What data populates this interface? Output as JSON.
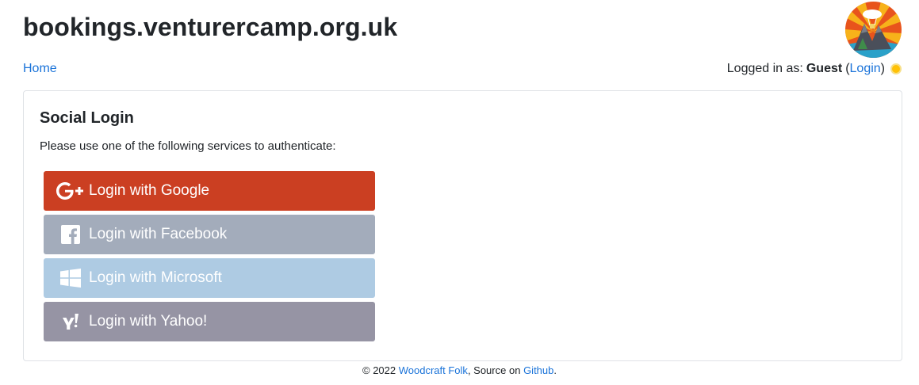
{
  "header": {
    "site_title": "bookings.venturercamp.org.uk",
    "logo_icon": "venturer-camp-logo-icon"
  },
  "nav": {
    "home_label": "Home",
    "logged_in_prefix": "Logged in as:",
    "user_name": "Guest",
    "login_open": "(",
    "login_label": "Login",
    "login_close": ")",
    "theme_icon": "sun-icon"
  },
  "card": {
    "title": "Social Login",
    "instruction": "Please use one of the following services to authenticate:",
    "buttons": [
      {
        "label": "Login with Google",
        "icon": "google-plus-icon",
        "color": "#cb3f22"
      },
      {
        "label": "Login with Facebook",
        "icon": "facebook-icon",
        "color": "#a3acbb"
      },
      {
        "label": "Login with Microsoft",
        "icon": "windows-icon",
        "color": "#aecbe3"
      },
      {
        "label": "Login with Yahoo!",
        "icon": "yahoo-icon",
        "color": "#9694a4"
      }
    ]
  },
  "footer": {
    "copyright": "© 2022",
    "org_link": "Woodcraft Folk",
    "source_text": ", Source on",
    "source_link": "Github",
    "end": "."
  },
  "colors": {
    "link": "#1a73d9",
    "text": "#212529",
    "card_border": "#dfe2e6"
  }
}
